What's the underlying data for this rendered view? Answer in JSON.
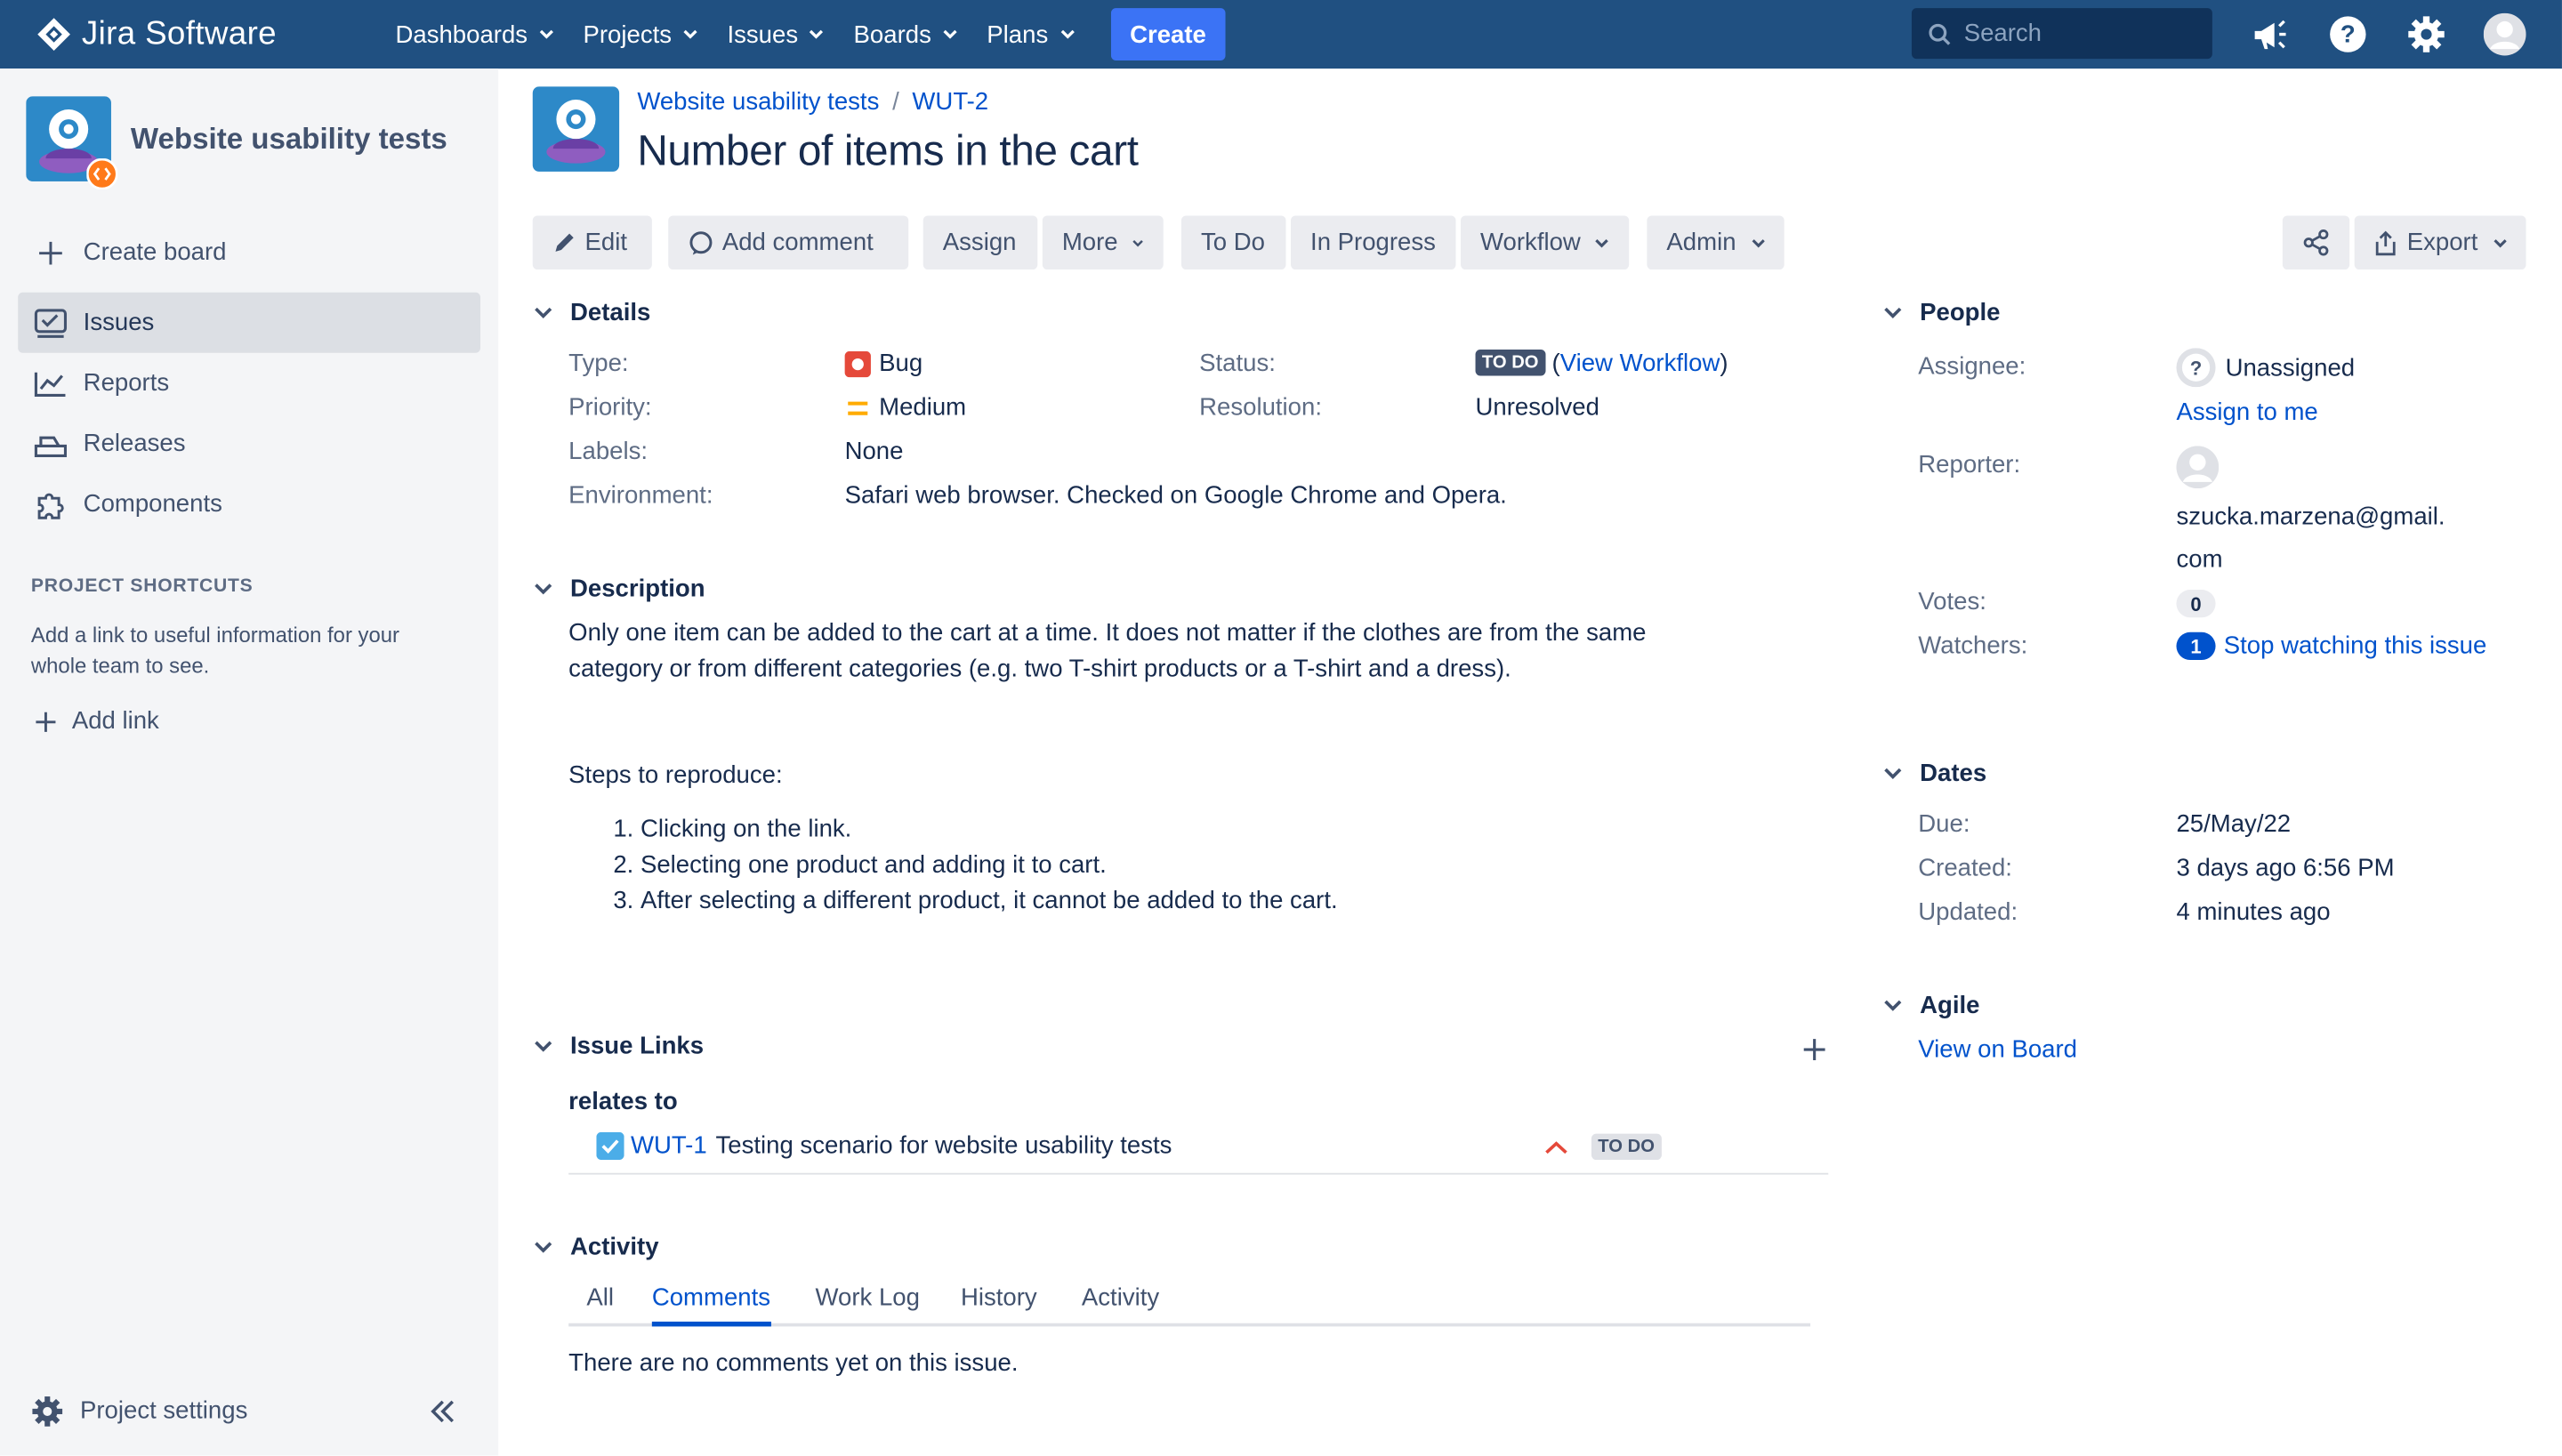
{
  "topbar": {
    "brand": "Jira Software",
    "nav": [
      "Dashboards",
      "Projects",
      "Issues",
      "Boards",
      "Plans"
    ],
    "create_label": "Create",
    "search_placeholder": "Search"
  },
  "sidebar": {
    "project_name": "Website usability tests",
    "create_board": "Create board",
    "items": [
      "Issues",
      "Reports",
      "Releases",
      "Components"
    ],
    "shortcuts_title": "PROJECT SHORTCUTS",
    "shortcuts_desc": "Add a link to useful information for your whole team to see.",
    "add_link": "Add link",
    "project_settings": "Project settings"
  },
  "issue": {
    "breadcrumb_project": "Website usability tests",
    "breadcrumb_sep": "/",
    "key": "WUT-2",
    "title": "Number of items in the cart"
  },
  "toolbar": {
    "edit": "Edit",
    "add_comment": "Add comment",
    "assign": "Assign",
    "more": "More",
    "todo": "To Do",
    "in_progress": "In Progress",
    "workflow": "Workflow",
    "admin": "Admin",
    "export": "Export"
  },
  "details": {
    "heading": "Details",
    "type_label": "Type:",
    "type": "Bug",
    "priority_label": "Priority:",
    "priority": "Medium",
    "labels_label": "Labels:",
    "labels": "None",
    "environment_label": "Environment:",
    "environment": "Safari web browser. Checked on Google Chrome and Opera.",
    "status_label": "Status:",
    "status": "TO DO",
    "view_workflow": "View Workflow",
    "paren_open": "(",
    "paren_close": ")",
    "resolution_label": "Resolution:",
    "resolution": "Unresolved"
  },
  "description": {
    "heading": "Description",
    "line1": "Only one item can be added to the cart at a time. It does not matter if the clothes are from the same",
    "line2": "category or from different categories (e.g. two T-shirt products or a T-shirt and a dress).",
    "steps_title": "Steps to reproduce:",
    "steps": [
      "Clicking on the link.",
      "Selecting  one product and adding it to cart.",
      "After selecting a different product, it cannot be added to the cart."
    ]
  },
  "issue_links": {
    "heading": "Issue Links",
    "relation": "relates to",
    "linked_key": "WUT-1",
    "linked_title": "Testing scenario for website usability tests",
    "linked_status": "TO DO"
  },
  "activity": {
    "heading": "Activity",
    "tabs": [
      "All",
      "Comments",
      "Work Log",
      "History",
      "Activity"
    ],
    "active_tab": "Comments",
    "empty": "There are no comments yet on this issue."
  },
  "people": {
    "heading": "People",
    "assignee_label": "Assignee:",
    "assignee": "Unassigned",
    "assign_to_me": "Assign to me",
    "reporter_label": "Reporter:",
    "reporter_line1": "szucka.marzena@gmail.",
    "reporter_line2": "com",
    "votes_label": "Votes:",
    "votes": "0",
    "watchers_label": "Watchers:",
    "watchers": "1",
    "stop_watching": "Stop watching this issue"
  },
  "dates": {
    "heading": "Dates",
    "due_label": "Due:",
    "due": "25/May/22",
    "created_label": "Created:",
    "created": "3 days ago 6:56 PM",
    "updated_label": "Updated:",
    "updated": "4 minutes ago"
  },
  "agile": {
    "heading": "Agile",
    "view_on_board": "View on Board"
  },
  "colors": {
    "topbar": "#205081",
    "create": "#3b73f5",
    "link": "#0052cc",
    "bug": "#e5493a",
    "medium": "#ffab00"
  }
}
